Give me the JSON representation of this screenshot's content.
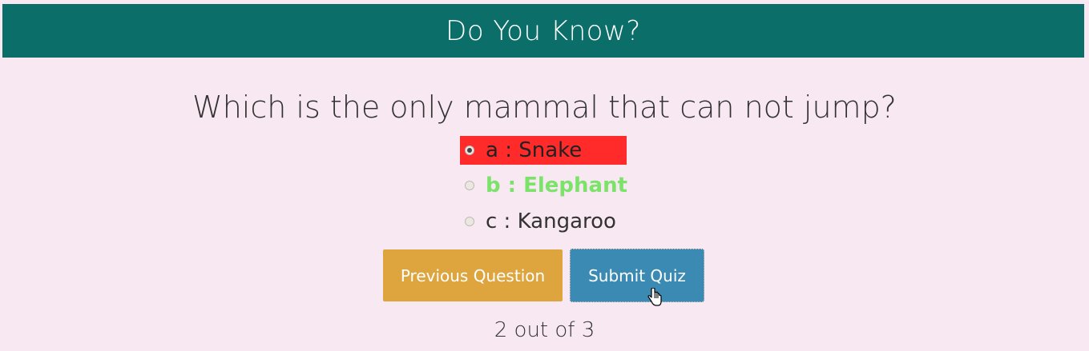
{
  "header": {
    "title": "Do You Know?"
  },
  "quiz": {
    "question": "Which is the only mammal that can not jump?",
    "options": [
      {
        "label": "a : Snake",
        "selected": true,
        "status": "incorrect",
        "highlight_color": "#ff2a2a"
      },
      {
        "label": "b : Elephant",
        "selected": false,
        "status": "correct",
        "text_color": "#7be36a"
      },
      {
        "label": "c : Kangaroo",
        "selected": false,
        "status": "neutral"
      }
    ]
  },
  "buttons": {
    "previous_label": "Previous Question",
    "submit_label": "Submit Quiz"
  },
  "progress": {
    "text": "2 out of 3"
  },
  "colors": {
    "header_bg": "#0b6e69",
    "page_bg": "#f8e8f2",
    "previous_bg": "#dea53f",
    "submit_bg": "#3a8ab3"
  },
  "cursor_icon": "hand-pointer-icon"
}
